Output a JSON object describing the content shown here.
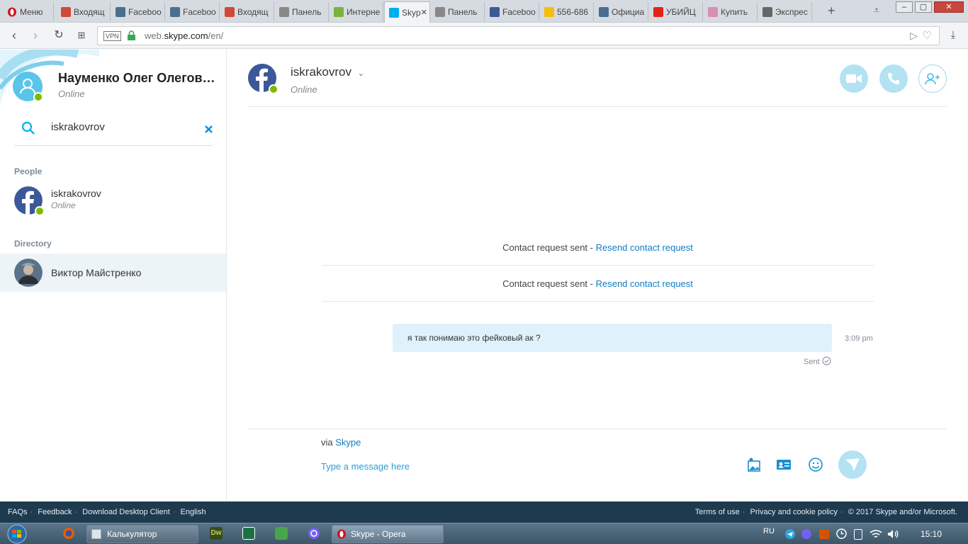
{
  "browser": {
    "menu_label": "Меню",
    "tabs": [
      {
        "label": "Входящ",
        "icon": "gmail-icon"
      },
      {
        "label": "Faceboo",
        "icon": "globe-icon"
      },
      {
        "label": "Faceboo",
        "icon": "globe-icon"
      },
      {
        "label": "Входящ",
        "icon": "gmail-icon"
      },
      {
        "label": "Панель",
        "icon": "document-icon"
      },
      {
        "label": "Интерне",
        "icon": "android-icon"
      },
      {
        "label": "Skyp",
        "icon": "skype-icon",
        "active": true
      },
      {
        "label": "Панель",
        "icon": "document-icon"
      },
      {
        "label": "Faceboo",
        "icon": "facebook-icon"
      },
      {
        "label": "556-686",
        "icon": "google-ads-icon"
      },
      {
        "label": "Официа",
        "icon": "globe-icon"
      },
      {
        "label": "УБИЙЦ",
        "icon": "youtube-icon"
      },
      {
        "label": "Купить",
        "icon": "shop-icon"
      },
      {
        "label": "Экспрес",
        "icon": "grid-icon"
      }
    ],
    "vpn_label": "VPN",
    "url_prefix": "web.",
    "url_host": "skype.com",
    "url_path": "/en/"
  },
  "profile": {
    "name": "Науменко Олег Олегович",
    "status": "Online"
  },
  "search": {
    "value": "iskrakovrov"
  },
  "sidebar": {
    "people_title": "People",
    "people": [
      {
        "name": "iskrakovrov",
        "status": "Online"
      }
    ],
    "directory_title": "Directory",
    "directory": [
      {
        "name": "Виктор Майстренко"
      }
    ]
  },
  "chat": {
    "name": "iskrakovrov",
    "status": "Online",
    "system_messages": [
      {
        "text": "Contact request sent - ",
        "link": "Resend contact request"
      },
      {
        "text": "Contact request sent - ",
        "link": "Resend contact request"
      }
    ],
    "message": {
      "text": "я так понимаю это фейковый ак ?",
      "time": "3:09 pm",
      "state": "Sent"
    },
    "via_prefix": "via ",
    "via_link": "Skype",
    "input_placeholder": "Type a message here"
  },
  "footer": {
    "left_links": [
      "FAQs",
      "Feedback",
      "Download Desktop Client",
      "English"
    ],
    "right_links": [
      "Terms of use",
      "Privacy and cookie policy"
    ],
    "copyright": "© 2017 Skype and/or Microsoft."
  },
  "taskbar": {
    "calculator_label": "Калькулятор",
    "skype_label": "Skype - Opera",
    "lang": "RU",
    "time": "15:10"
  },
  "colors": {
    "accent": "#00aff0",
    "link": "#0f7cc4",
    "online": "#7fba00",
    "footer_bg": "#1d3a4f",
    "bubble": "#dff1fb"
  }
}
